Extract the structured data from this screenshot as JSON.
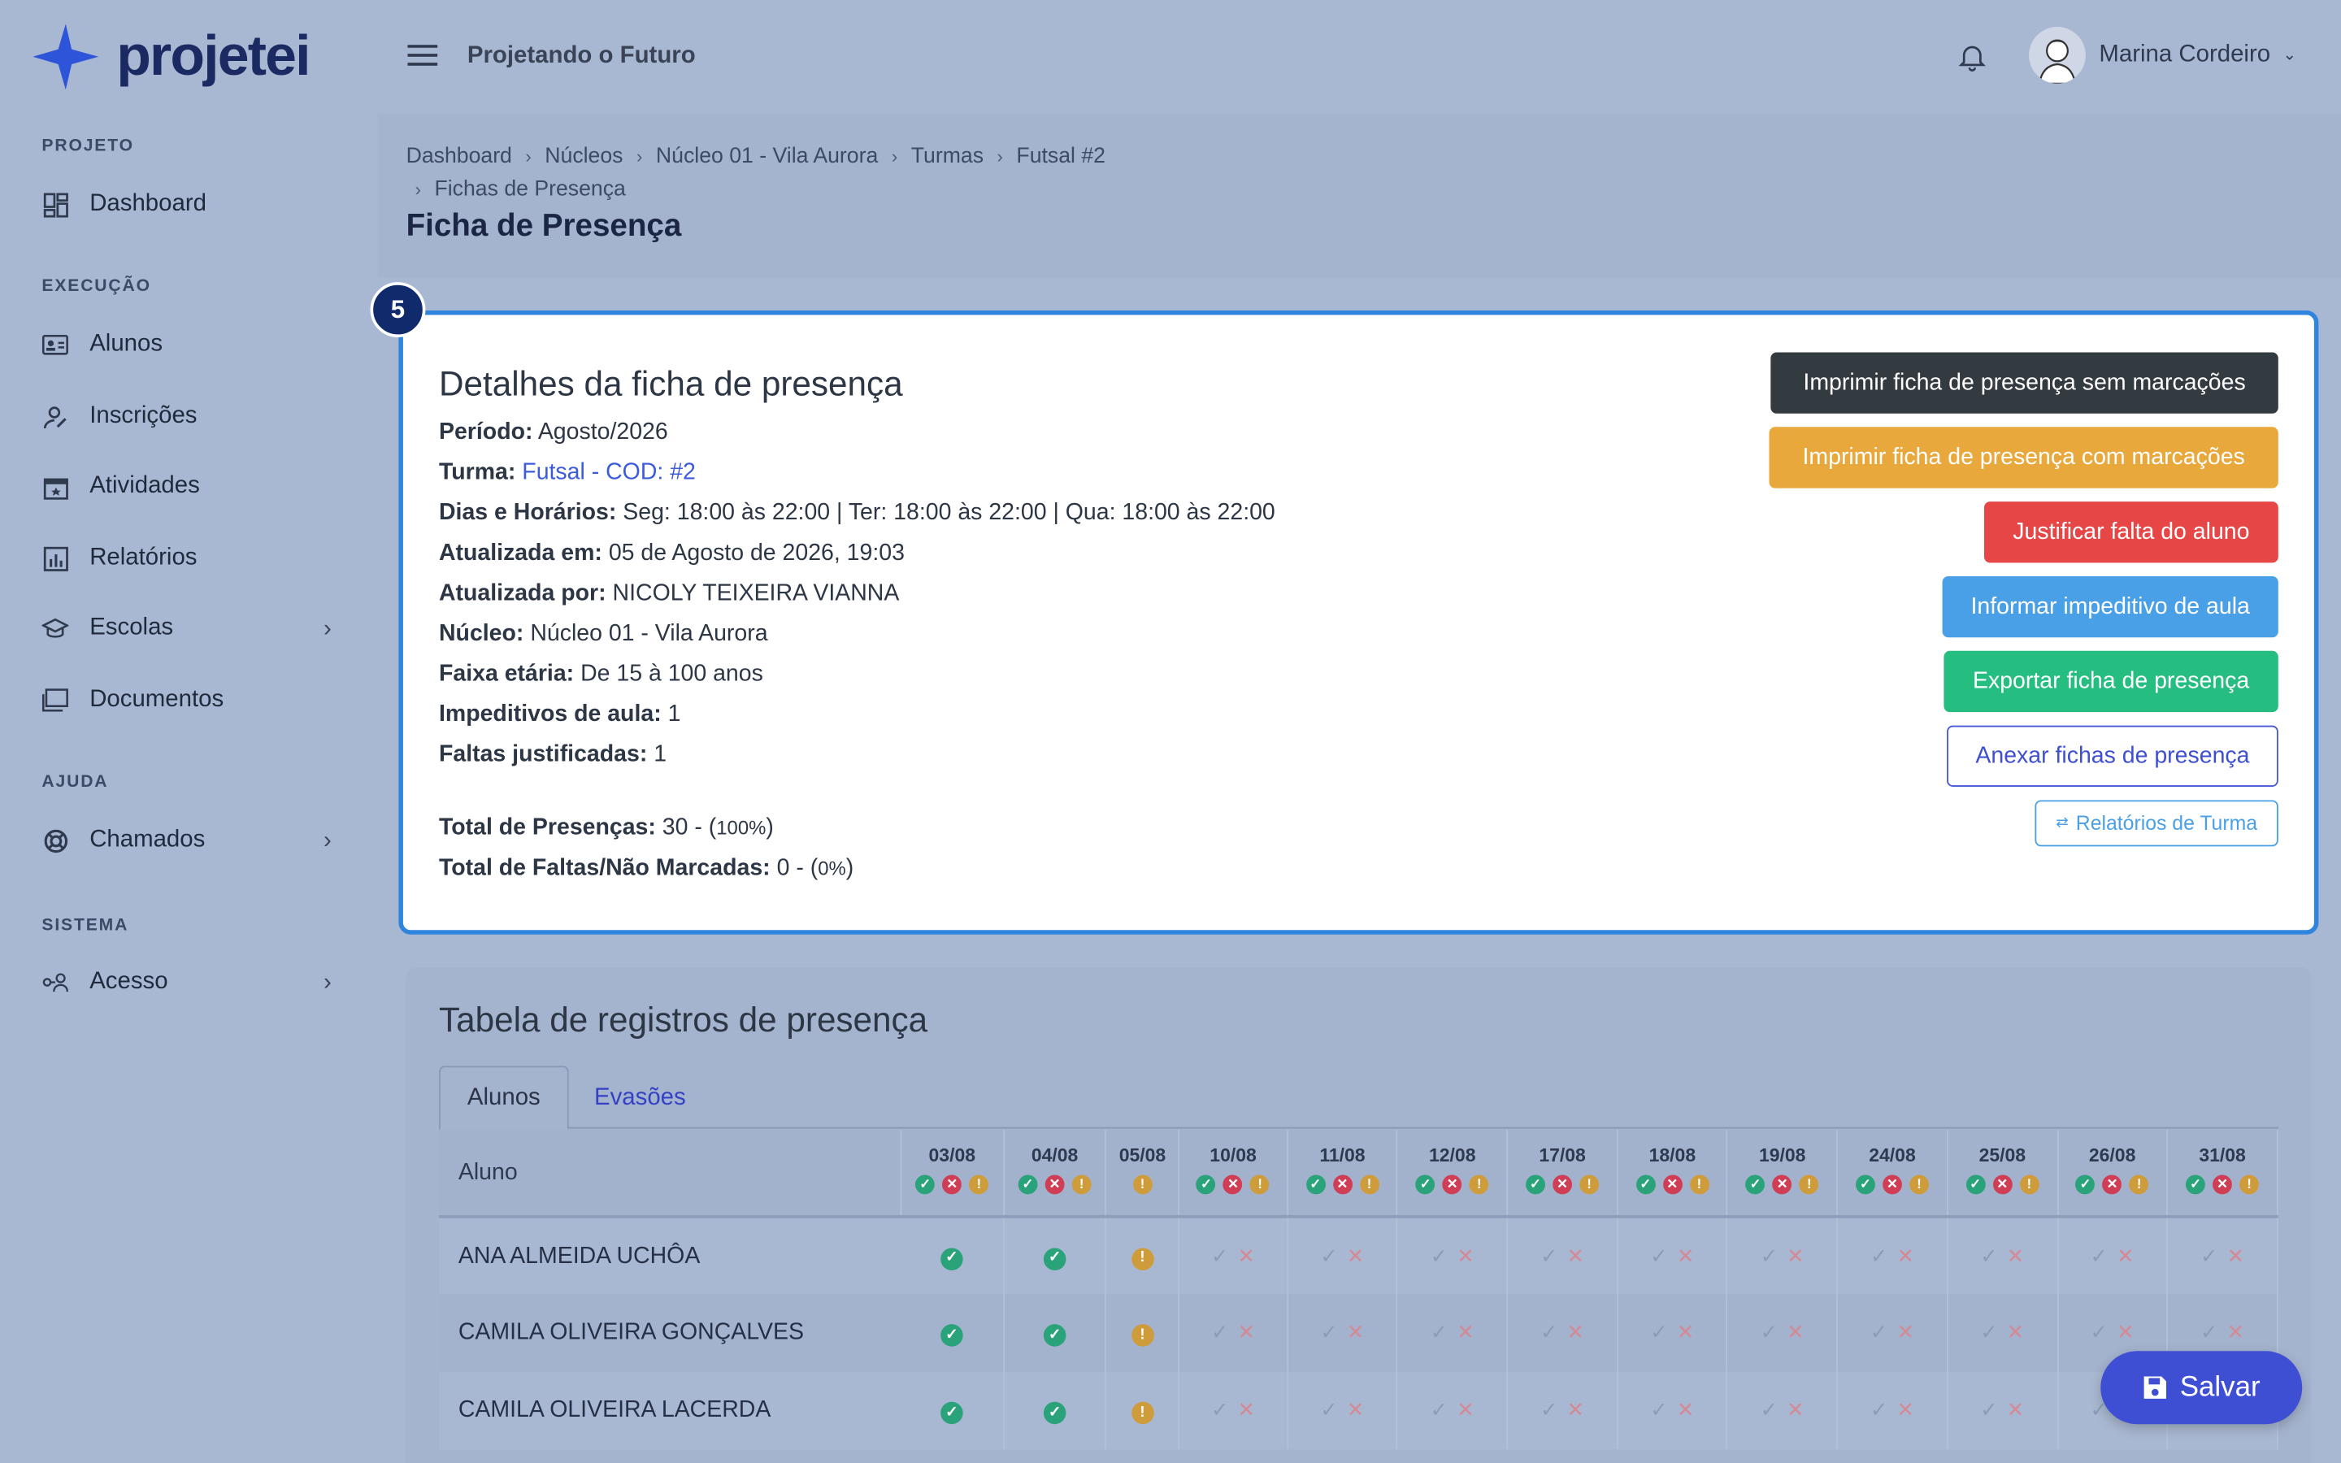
{
  "brand": {
    "name": "projetei"
  },
  "sidebar": {
    "sections": [
      {
        "label": "PROJETO",
        "items": [
          {
            "label": "Dashboard",
            "icon": "dashboard-icon"
          }
        ]
      },
      {
        "label": "EXECUÇÃO",
        "items": [
          {
            "label": "Alunos",
            "icon": "id-card-icon"
          },
          {
            "label": "Inscrições",
            "icon": "user-edit-icon"
          },
          {
            "label": "Atividades",
            "icon": "calendar-icon"
          },
          {
            "label": "Relatórios",
            "icon": "chart-icon"
          },
          {
            "label": "Escolas",
            "icon": "school-icon",
            "has_submenu": true
          },
          {
            "label": "Documentos",
            "icon": "folder-icon"
          }
        ]
      },
      {
        "label": "AJUDA",
        "items": [
          {
            "label": "Chamados",
            "icon": "lifebuoy-icon",
            "has_submenu": true
          }
        ]
      },
      {
        "label": "SISTEMA",
        "items": [
          {
            "label": "Acesso",
            "icon": "key-user-icon",
            "has_submenu": true
          }
        ]
      }
    ]
  },
  "topbar": {
    "project": "Projetando o Futuro",
    "user": "Marina Cordeiro"
  },
  "breadcrumb": [
    "Dashboard",
    "Núcleos",
    "Núcleo 01 - Vila Aurora",
    "Turmas",
    "Futsal #2",
    "Fichas de Presença"
  ],
  "page_title": "Ficha de Presença",
  "step": "5",
  "details": {
    "title": "Detalhes da ficha de presença",
    "periodo_label": "Período:",
    "periodo": "Agosto/2026",
    "turma_label": "Turma:",
    "turma": "Futsal - COD: #2",
    "dias_label": "Dias e Horários:",
    "dias": "Seg: 18:00 às 22:00 | Ter: 18:00 às 22:00 | Qua: 18:00 às 22:00",
    "atualizada_em_label": "Atualizada em:",
    "atualizada_em": "05 de Agosto de 2026, 19:03",
    "atualizada_por_label": "Atualizada por:",
    "atualizada_por": "NICOLY TEIXEIRA VIANNA",
    "nucleo_label": "Núcleo:",
    "nucleo": "Núcleo 01 - Vila Aurora",
    "faixa_label": "Faixa etária:",
    "faixa": "De 15 à 100 anos",
    "impeditivos_label": "Impeditivos de aula:",
    "impeditivos": "1",
    "faltas_just_label": "Faltas justificadas:",
    "faltas_just": "1",
    "total_pres_label": "Total de Presenças:",
    "total_pres": "30 - (",
    "total_pres_pct": "100%",
    "total_faltas_label": "Total de Faltas/Não Marcadas:",
    "total_faltas": "0 - (",
    "total_faltas_pct": "0%",
    "close_paren": ")"
  },
  "actions": {
    "print_blank": "Imprimir ficha de presença sem marcações",
    "print_marked": "Imprimir ficha de presença com marcações",
    "justify": "Justificar falta do aluno",
    "impediment": "Informar impeditivo de aula",
    "export": "Exportar ficha de presença",
    "attach": "Anexar fichas de presença",
    "reports": "Relatórios de Turma"
  },
  "table_card": {
    "title": "Tabela de registros de presença",
    "tabs": [
      "Alunos",
      "Evasões"
    ],
    "col_student": "Aluno",
    "dates": [
      "03/08",
      "04/08",
      "05/08",
      "10/08",
      "11/08",
      "12/08",
      "17/08",
      "18/08",
      "19/08",
      "24/08",
      "25/08",
      "26/08",
      "31/08"
    ],
    "rows": [
      {
        "name": "ANA ALMEIDA UCHÔA",
        "marks": [
          "present",
          "present",
          "justified"
        ]
      },
      {
        "name": "CAMILA OLIVEIRA GONÇALVES",
        "marks": [
          "present",
          "present",
          "justified"
        ]
      },
      {
        "name": "CAMILA OLIVEIRA LACERDA",
        "marks": [
          "present",
          "present",
          "justified"
        ]
      }
    ]
  },
  "save_label": "Salvar"
}
